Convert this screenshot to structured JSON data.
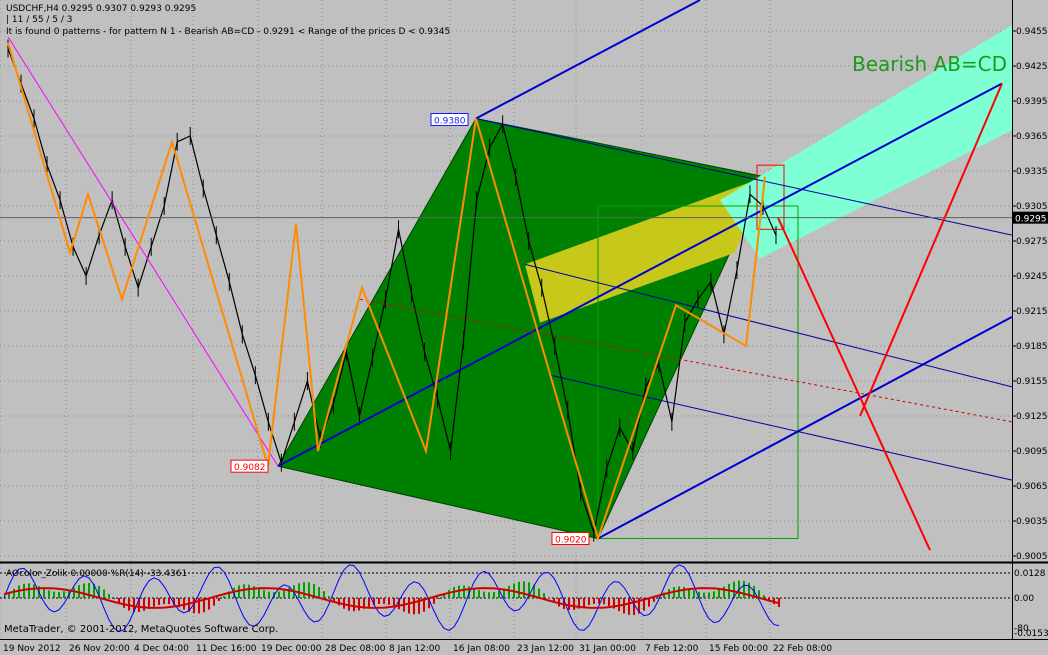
{
  "header": {
    "symbol_line": "USDCHF,H4  0.9295 0.9307 0.9293 0.9295",
    "params_line": "| 11 / 55 / 5 / 3",
    "info_line": "It is found 0 patterns  -  for pattern N 1 - Bearish AB=CD - 0.9291 < Range of the prices D < 0.9345"
  },
  "pattern_title": "Bearish AB=CD",
  "current_price": "0.9295",
  "point_labels": [
    {
      "text": "0.9380",
      "color": "#1a1aff"
    },
    {
      "text": "0.9082",
      "color": "#ff0000"
    },
    {
      "text": "0.9020",
      "color": "#ff0000"
    }
  ],
  "indicator": {
    "label": "AOcolor_Zolik 0.00000  %R(14) -33.4361",
    "axis_labels": [
      "0.0128",
      "0.00",
      "-0.015300",
      "-80"
    ]
  },
  "watermark": "MetaTrader, © 2001-2012, MetaQuotes Software Corp.",
  "chart_data": {
    "type": "line",
    "title": "USDCHF,H4",
    "ylim": [
      0.9,
      0.947
    ],
    "y_ticks": [
      "0.9455",
      "0.9425",
      "0.9395",
      "0.9365",
      "0.9335",
      "0.9305",
      "0.9275",
      "0.9245",
      "0.9215",
      "0.9185",
      "0.9155",
      "0.9125",
      "0.9095",
      "0.9065",
      "0.9035",
      "0.9005"
    ],
    "x_ticks": [
      "19 Nov 2012",
      "26 Nov 20:00",
      "4 Dec 04:00",
      "11 Dec 16:00",
      "19 Dec 00:00",
      "28 Dec 08:00",
      "8 Jan 12:00",
      "16 Jan 08:00",
      "23 Jan 12:00",
      "31 Jan 00:00",
      "7 Feb 12:00",
      "15 Feb 00:00",
      "22 Feb 08:00"
    ],
    "last_price": 0.9295,
    "series": [
      {
        "values": [
          0.944,
          0.941,
          0.938,
          0.934,
          0.931,
          0.927,
          0.9245,
          0.928,
          0.931,
          0.927,
          0.9235,
          0.927,
          0.9305,
          0.936,
          0.9365,
          0.932,
          0.928,
          0.924,
          0.9195,
          0.916,
          0.912,
          0.9085,
          0.912,
          0.9155,
          0.9105,
          0.9135,
          0.918,
          0.9125,
          0.9175,
          0.9225,
          0.9285,
          0.923,
          0.918,
          0.914,
          0.9095,
          0.919,
          0.931,
          0.9355,
          0.9375,
          0.933,
          0.9275,
          0.9235,
          0.9185,
          0.913,
          0.906,
          0.9025,
          0.908,
          0.9115,
          0.9095,
          0.915,
          0.917,
          0.912,
          0.9205,
          0.9225,
          0.924,
          0.9195,
          0.925,
          0.9315,
          0.9305,
          0.928
        ]
      },
      {
        "values": [
          0.9445,
          0.9265,
          0.9315,
          0.9225,
          0.936,
          0.9082,
          0.929,
          0.9095,
          0.9235,
          0.9095,
          0.938,
          0.9155,
          0.902,
          0.922,
          0.9185,
          0.933
        ]
      }
    ]
  }
}
